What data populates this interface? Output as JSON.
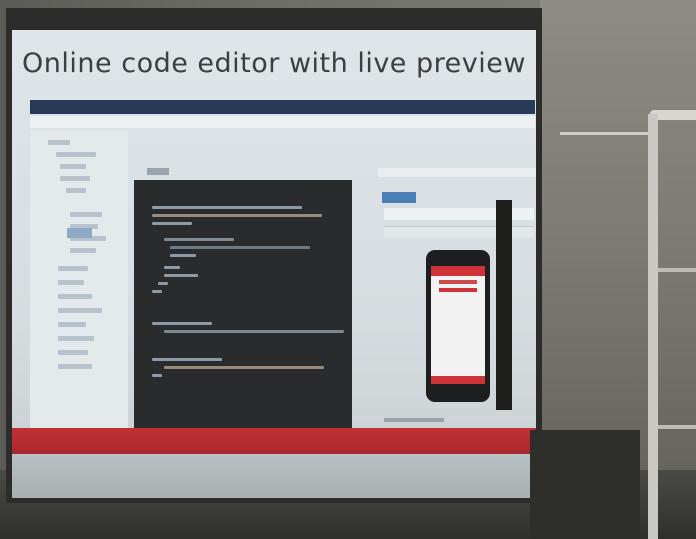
{
  "slide": {
    "title": "Online code editor with live preview"
  },
  "colors": {
    "slide_background": "#dfe6ea",
    "menubar": "#273a57",
    "editor": "#2a2b2d",
    "accent_red": "#cf3238",
    "preview_badge": "#4a7fb5"
  }
}
